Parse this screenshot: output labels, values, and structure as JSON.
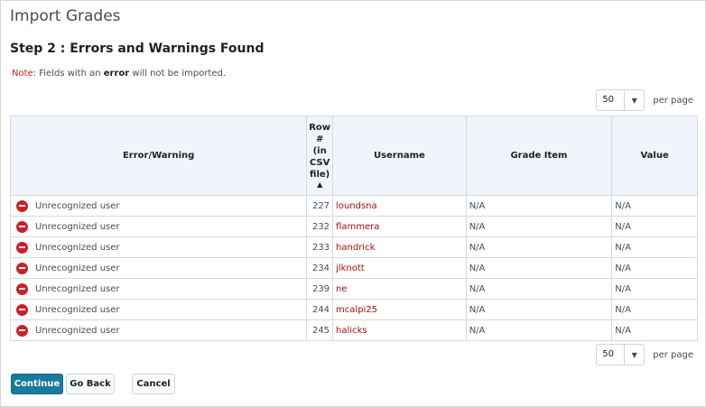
{
  "page": {
    "title": "Import Grades",
    "step_title": "Step 2 : Errors and Warnings Found",
    "note_label": "Note:",
    "note_prefix": "Fields with an",
    "note_emphasis": "error",
    "note_suffix": "will not be imported."
  },
  "pager": {
    "selected": "50",
    "per_page_label": "per page"
  },
  "table": {
    "columns": {
      "error_warning": "Error/Warning",
      "row_number_lines": [
        "Row",
        "#",
        "(in",
        "CSV",
        "file)"
      ],
      "sort_indicator": "▲",
      "username": "Username",
      "grade_item": "Grade Item",
      "value": "Value"
    },
    "rows": [
      {
        "message": "Unrecognized user",
        "row": "227",
        "username": "loundsna",
        "grade_item": "N/A",
        "value": "N/A"
      },
      {
        "message": "Unrecognized user",
        "row": "232",
        "username": "flammera",
        "grade_item": "N/A",
        "value": "N/A"
      },
      {
        "message": "Unrecognized user",
        "row": "233",
        "username": "handrick",
        "grade_item": "N/A",
        "value": "N/A"
      },
      {
        "message": "Unrecognized user",
        "row": "234",
        "username": "jlknott",
        "grade_item": "N/A",
        "value": "N/A"
      },
      {
        "message": "Unrecognized user",
        "row": "239",
        "username": "ne",
        "grade_item": "N/A",
        "value": "N/A"
      },
      {
        "message": "Unrecognized user",
        "row": "244",
        "username": "mcalpi25",
        "grade_item": "N/A",
        "value": "N/A"
      },
      {
        "message": "Unrecognized user",
        "row": "245",
        "username": "halicks",
        "grade_item": "N/A",
        "value": "N/A"
      }
    ]
  },
  "buttons": {
    "continue": "Continue",
    "go_back": "Go Back",
    "cancel": "Cancel"
  },
  "colors": {
    "primary_button": "#1a7a9e",
    "error_icon": "#cd2026",
    "username_link": "#a80f0f"
  },
  "icons": {
    "row_status": "error-icon",
    "select_caret": "chevron-down-icon"
  }
}
